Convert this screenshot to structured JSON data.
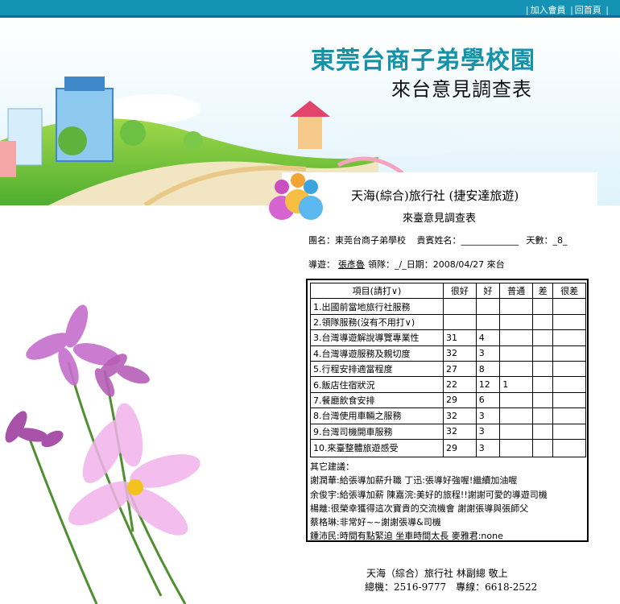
{
  "topnav": {
    "join": "加入會員",
    "home": "回首頁"
  },
  "banner": {
    "school_title": "東莞台商子弟學校園",
    "survey_title": "來台意見調查表"
  },
  "doc": {
    "agency": "天海(綜合)旅行社 (捷安達旅遊)",
    "subtitle": "來臺意見調查表",
    "group_label": "團名：東莞台商子弟學校",
    "guest_label": "貴賓姓名：",
    "days_label": "天數：_8_",
    "guide_label": "導遊：",
    "guide_name": "張彥魯",
    "leader_date": "領隊：_/_日期：2008/04/27 來台"
  },
  "table": {
    "headers": [
      "項目(請打∨)",
      "很好",
      "好",
      "普通",
      "差",
      "很差"
    ],
    "rows": [
      {
        "item": "1.出國前當地旅行社服務",
        "v1": "",
        "v2": "",
        "v3": "",
        "v4": "",
        "v5": ""
      },
      {
        "item": "2.領隊服務(沒有不用打∨)",
        "v1": "",
        "v2": "",
        "v3": "",
        "v4": "",
        "v5": ""
      },
      {
        "item": "3.台灣導遊解說導覽專業性",
        "v1": "31",
        "v2": "4",
        "v3": "",
        "v4": "",
        "v5": ""
      },
      {
        "item": "4.台灣導遊服務及親切度",
        "v1": "32",
        "v2": "3",
        "v3": "",
        "v4": "",
        "v5": ""
      },
      {
        "item": "5.行程安排適當程度",
        "v1": "27",
        "v2": "8",
        "v3": "",
        "v4": "",
        "v5": ""
      },
      {
        "item": "6.飯店住宿狀況",
        "v1": "22",
        "v2": "12",
        "v3": "1",
        "v4": "",
        "v5": ""
      },
      {
        "item": "7.餐廳飲食安排",
        "v1": "29",
        "v2": "6",
        "v3": "",
        "v4": "",
        "v5": ""
      },
      {
        "item": "8.台灣使用車輛之服務",
        "v1": "32",
        "v2": "3",
        "v3": "",
        "v4": "",
        "v5": ""
      },
      {
        "item": "9.台灣司機開車服務",
        "v1": "32",
        "v2": "3",
        "v3": "",
        "v4": "",
        "v5": ""
      },
      {
        "item": "10.來臺整體旅遊感受",
        "v1": "29",
        "v2": "3",
        "v3": "",
        "v4": "",
        "v5": ""
      }
    ]
  },
  "comments": {
    "label": "其它建議：",
    "lines": [
      "謝潤華:給張導加薪升職 丁迅:張導好強喔!繼續加油喔",
      "余俊宇:給張導加薪 陳嘉浣:美好的旅程!!謝謝可愛的導遊司機",
      "楊離:很榮幸獲得這次寶貴的交流機會 謝謝張導與張師父",
      "蔡格琳:非常好~~謝謝張導&司機",
      "鍾沛民:時間有點緊迫 坐車時間太長 麥雅君:none"
    ]
  },
  "footer": {
    "line1": "天海（綜合）旅行社 林副總 敬上",
    "line2": "總機：2516-9777　專線：6618-2522"
  },
  "colors": {
    "topbar": "#1493b4",
    "title_teal": "#1592a8"
  }
}
